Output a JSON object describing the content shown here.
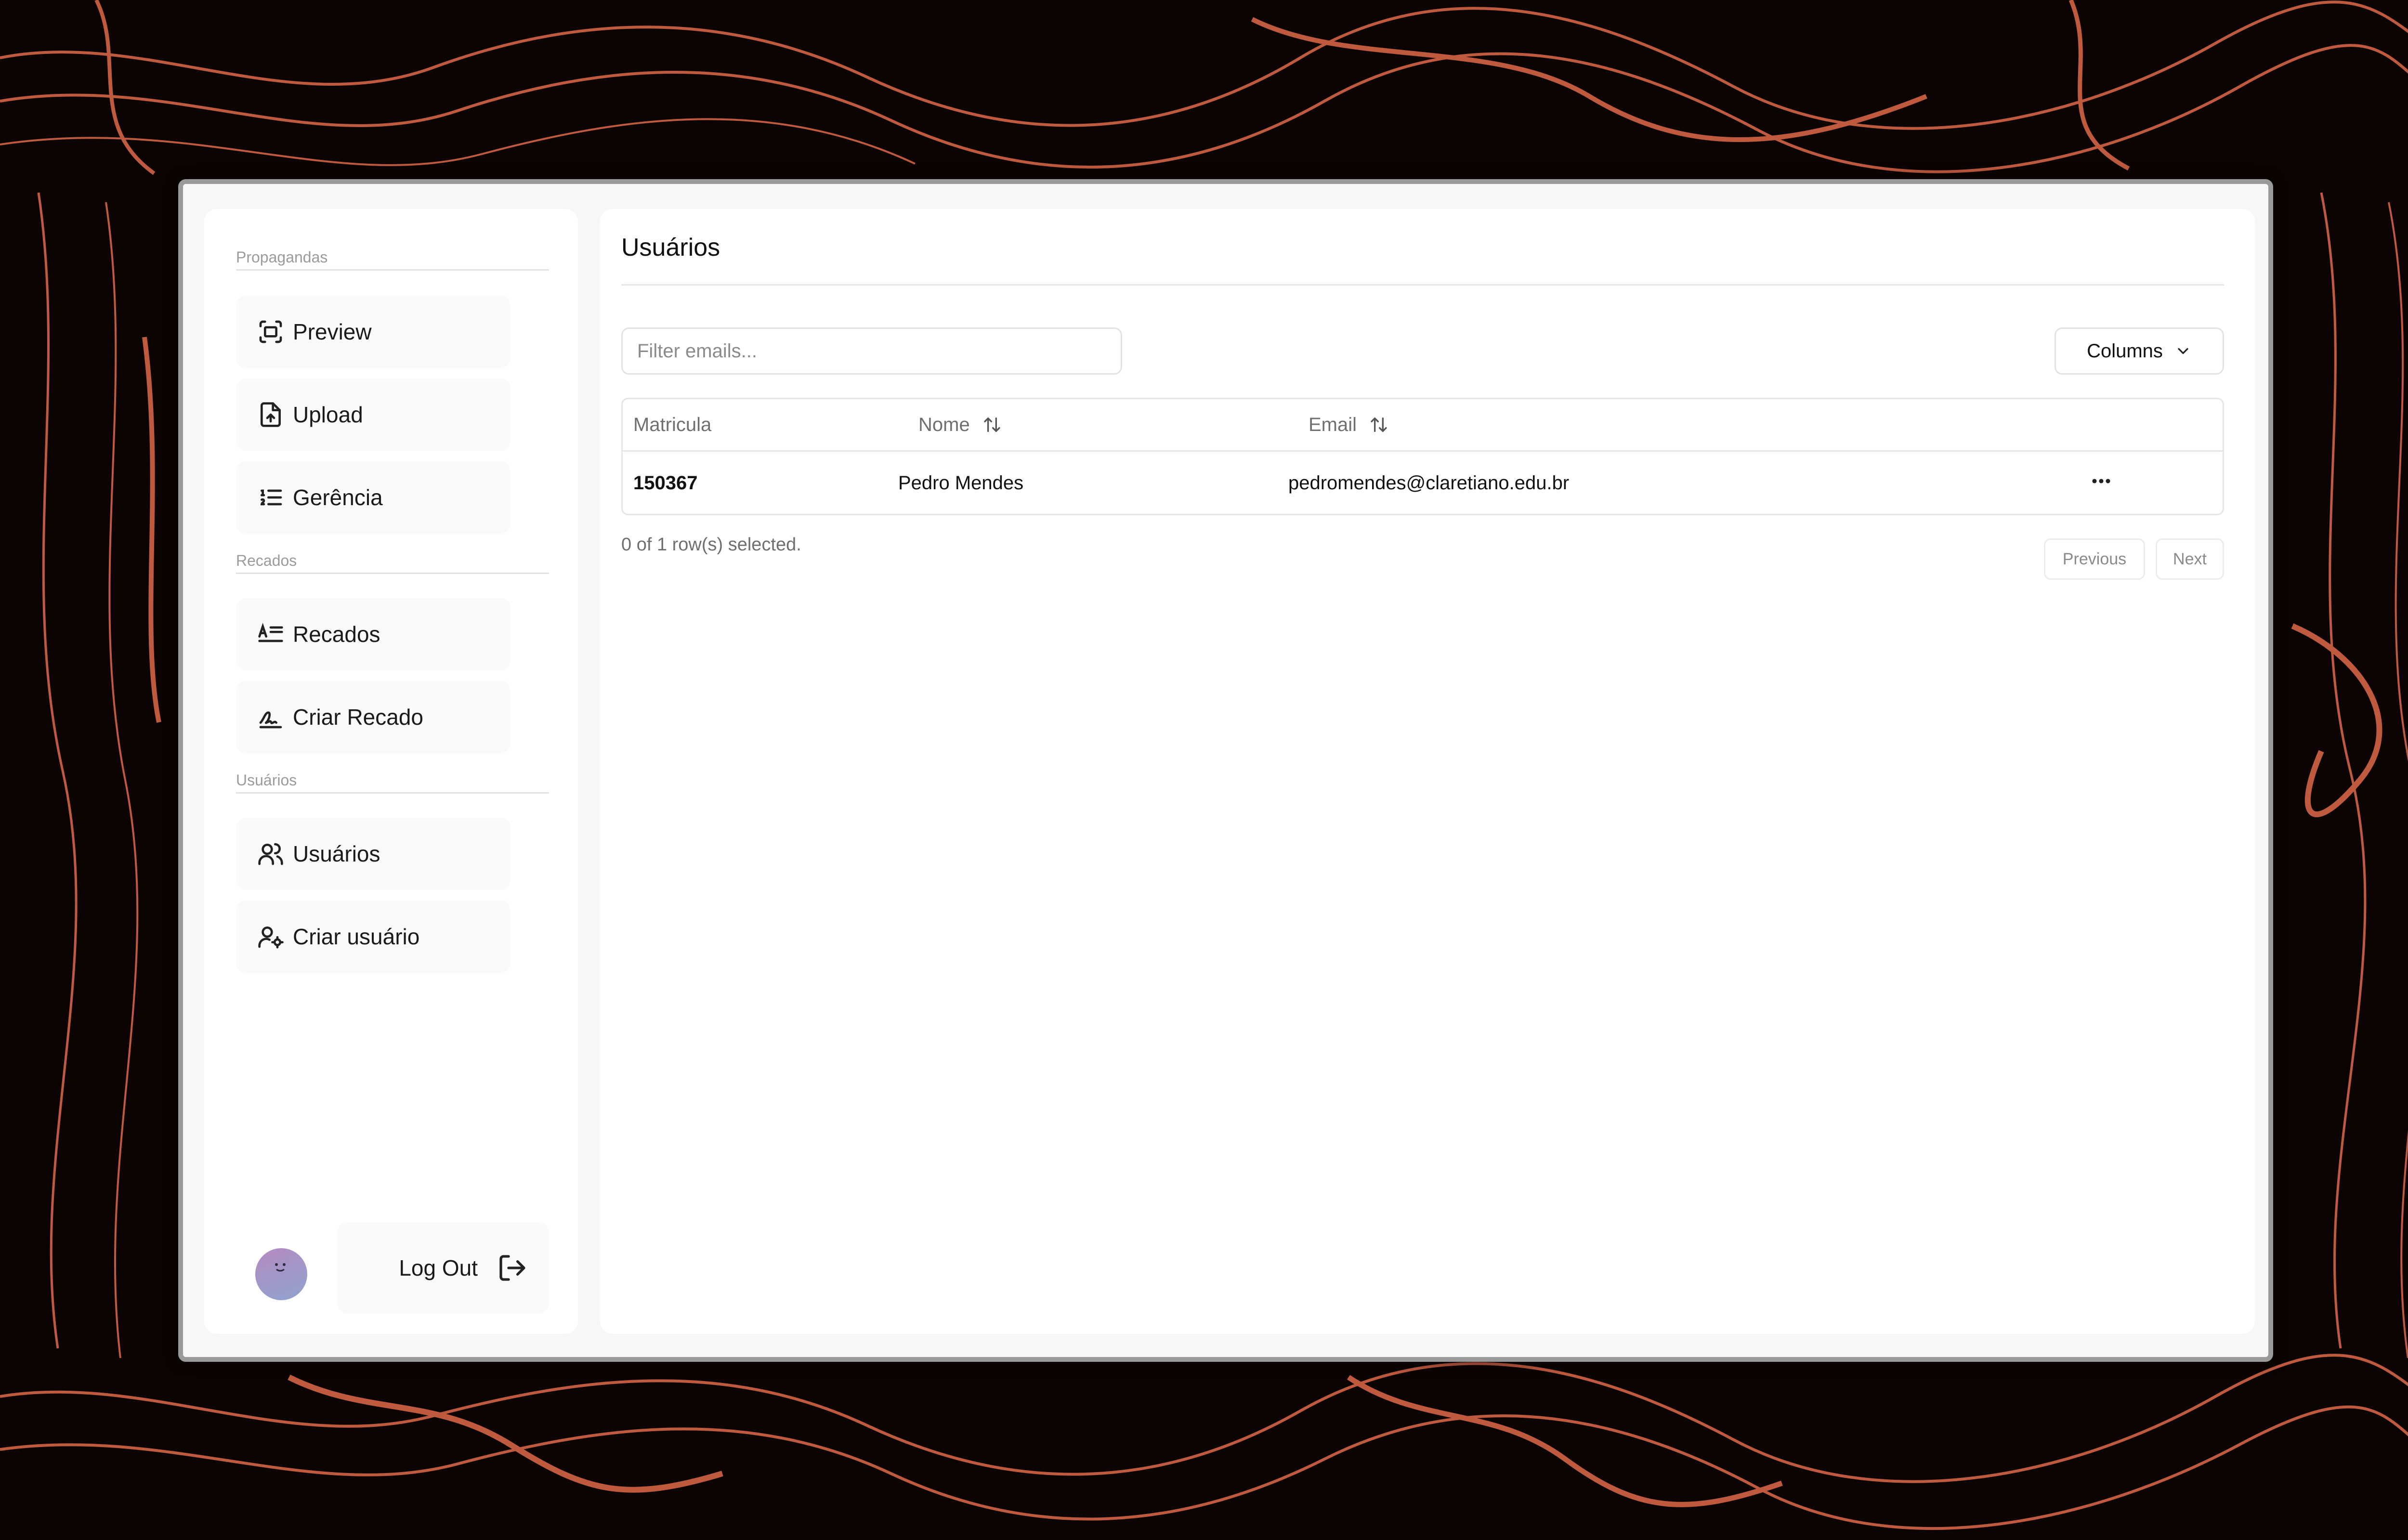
{
  "sidebar": {
    "sections": [
      {
        "title": "Propagandas",
        "items": [
          {
            "label": "Preview",
            "icon": "scan-preview-icon"
          },
          {
            "label": "Upload",
            "icon": "file-upload-icon"
          },
          {
            "label": "Gerência",
            "icon": "list-ordered-icon"
          }
        ]
      },
      {
        "title": "Recados",
        "items": [
          {
            "label": "Recados",
            "icon": "text-message-icon"
          },
          {
            "label": "Criar Recado",
            "icon": "signature-icon"
          }
        ]
      },
      {
        "title": "Usuários",
        "items": [
          {
            "label": "Usuários",
            "icon": "users-icon"
          },
          {
            "label": "Criar usuário",
            "icon": "user-cog-icon"
          }
        ]
      }
    ],
    "logout_label": "Log Out"
  },
  "main": {
    "title": "Usuários",
    "filter_placeholder": "Filter emails...",
    "columns_label": "Columns",
    "table": {
      "headers": [
        "Matricula",
        "Nome",
        "Email"
      ],
      "rows": [
        {
          "matricula": "150367",
          "nome": "Pedro Mendes",
          "email": "pedromendes@claretiano.edu.br"
        }
      ]
    },
    "selection_status": "0 of 1 row(s) selected.",
    "pagination": {
      "previous": "Previous",
      "next": "Next"
    }
  },
  "colors": {
    "background": "#0c0403",
    "contour": "#e0694a",
    "panel": "#ffffff",
    "frame": "#f7f7f7"
  }
}
